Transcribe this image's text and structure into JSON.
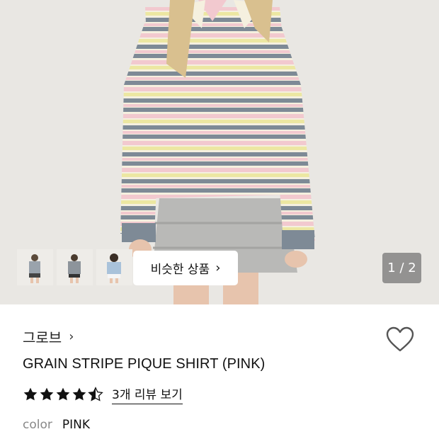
{
  "gallery": {
    "counter": "1 / 2",
    "similar_button_label": "비슷한 상품",
    "thumbnail_count": 3
  },
  "product": {
    "brand": "그로브",
    "name": "GRAIN STRIPE PIQUE SHIRT (PINK)",
    "rating": 4.5,
    "review_link": "3개 리뷰 보기",
    "option_label": "color",
    "option_value": "PINK"
  },
  "colors": {
    "stripe_pink": "#f2c9cf",
    "stripe_gray": "#7e8a96",
    "stripe_yellow": "#ece7a2",
    "skirt_gray": "#b9b9b7"
  },
  "icons": {
    "heart": "heart-icon",
    "brand_chevron": "chevron-right-icon",
    "button_chevron": "chevron-right-icon",
    "star": "star-icon"
  }
}
